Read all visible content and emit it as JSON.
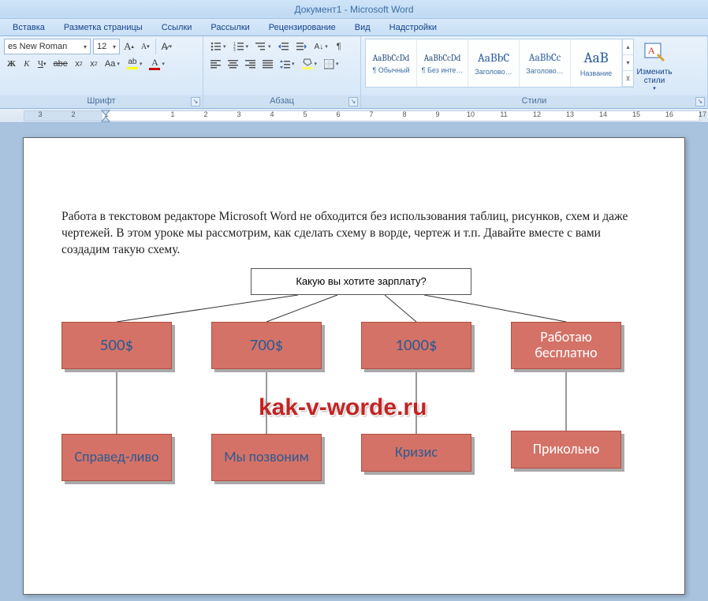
{
  "title": "Документ1 - Microsoft Word",
  "tabs": [
    "Вставка",
    "Разметка страницы",
    "Ссылки",
    "Рассылки",
    "Рецензирование",
    "Вид",
    "Надстройки"
  ],
  "font": {
    "name": "es New Roman",
    "size": "12",
    "group_label": "Шрифт"
  },
  "paragraph": {
    "group_label": "Абзац"
  },
  "styles": {
    "group_label": "Стили",
    "items": [
      {
        "preview": "AaBbCcDd",
        "name": "¶ Обычный",
        "psize": "11"
      },
      {
        "preview": "AaBbCcDd",
        "name": "¶ Без инте…",
        "psize": "11"
      },
      {
        "preview": "AaBbC",
        "name": "Заголово…",
        "psize": "14"
      },
      {
        "preview": "AaBbCc",
        "name": "Заголово…",
        "psize": "13"
      },
      {
        "preview": "AaB",
        "name": "Название",
        "psize": "18"
      }
    ],
    "change_label": "Изменить стили"
  },
  "ruler_numbers": [
    "3",
    "2",
    "1",
    "",
    "1",
    "2",
    "3",
    "4",
    "5",
    "6",
    "7",
    "8",
    "9",
    "10",
    "11",
    "12",
    "13",
    "14",
    "15",
    "16",
    "17"
  ],
  "document": {
    "paragraph": "Работа в текстовом редакторе Microsoft Word не обходится без использования таблиц, рисунков, схем и даже чертежей. В этом уроке мы рассмотрим, как сделать схему в ворде, чертеж и т.п. Давайте вместе с вами создадим такую схему.",
    "root_question": "Какую вы хотите зарплату?",
    "options": [
      "500$",
      "700$",
      "1000$",
      "Работаю бесплатно"
    ],
    "answers": [
      "Справед-ливо",
      "Мы позвоним",
      "Кризис",
      "Прикольно"
    ],
    "watermark": "kak-v-worde.ru"
  }
}
